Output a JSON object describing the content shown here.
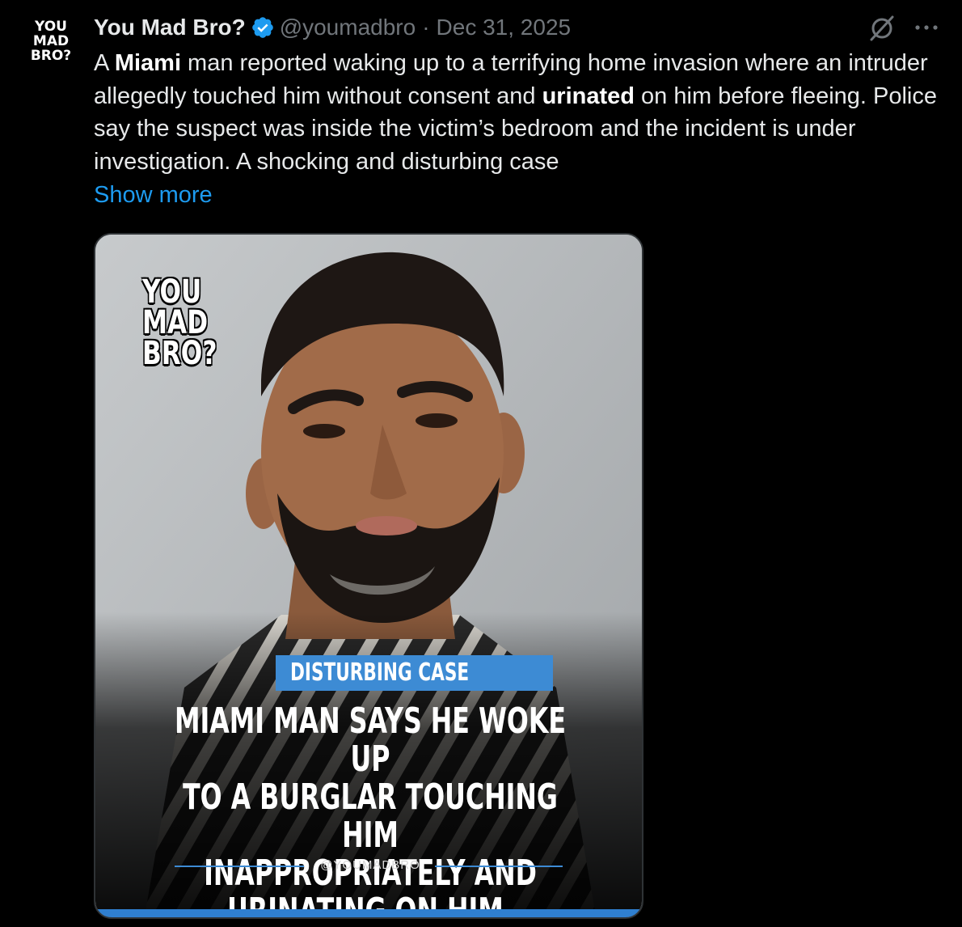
{
  "author": {
    "avatar_lines": [
      "YOU",
      "MAD",
      "BRO?"
    ],
    "display_name": "You Mad Bro?",
    "handle": "@youmadbro",
    "separator": "·",
    "date": "Dec 31, 2025",
    "verified_icon": "verified-badge-icon"
  },
  "header_icons": {
    "grok": "grok-icon",
    "more": "more-options-icon"
  },
  "post": {
    "text_segments": [
      {
        "text": "A ",
        "bold": false
      },
      {
        "text": "Miami",
        "bold": true
      },
      {
        "text": " man reported waking up to a terrifying home invasion where an intruder allegedly touched him without consent and ",
        "bold": false
      },
      {
        "text": "urinated",
        "bold": true
      },
      {
        "text": " on him before fleeing. Police say the suspect was inside the victim’s bedroom and the incident is under investigation. A shocking and disturbing case",
        "bold": false
      }
    ],
    "show_more": "Show more"
  },
  "media": {
    "logo_lines": [
      "YOU",
      "MAD",
      "BRO?"
    ],
    "badge": "DISTURBING CASE",
    "headline_lines": [
      "MIAMI MAN SAYS HE WOKE UP",
      "TO A BURGLAR TOUCHING HIM",
      "INAPPROPRIATELY AND",
      "URINATING ON HIM, POLICE SAY!"
    ],
    "footer_handle": "@YOUMADBRO"
  },
  "colors": {
    "background": "#000000",
    "text": "#e7e9ea",
    "muted": "#71767b",
    "link": "#1d9bf0",
    "verified": "#1d9bf0",
    "badge": "#3d8bd4"
  }
}
